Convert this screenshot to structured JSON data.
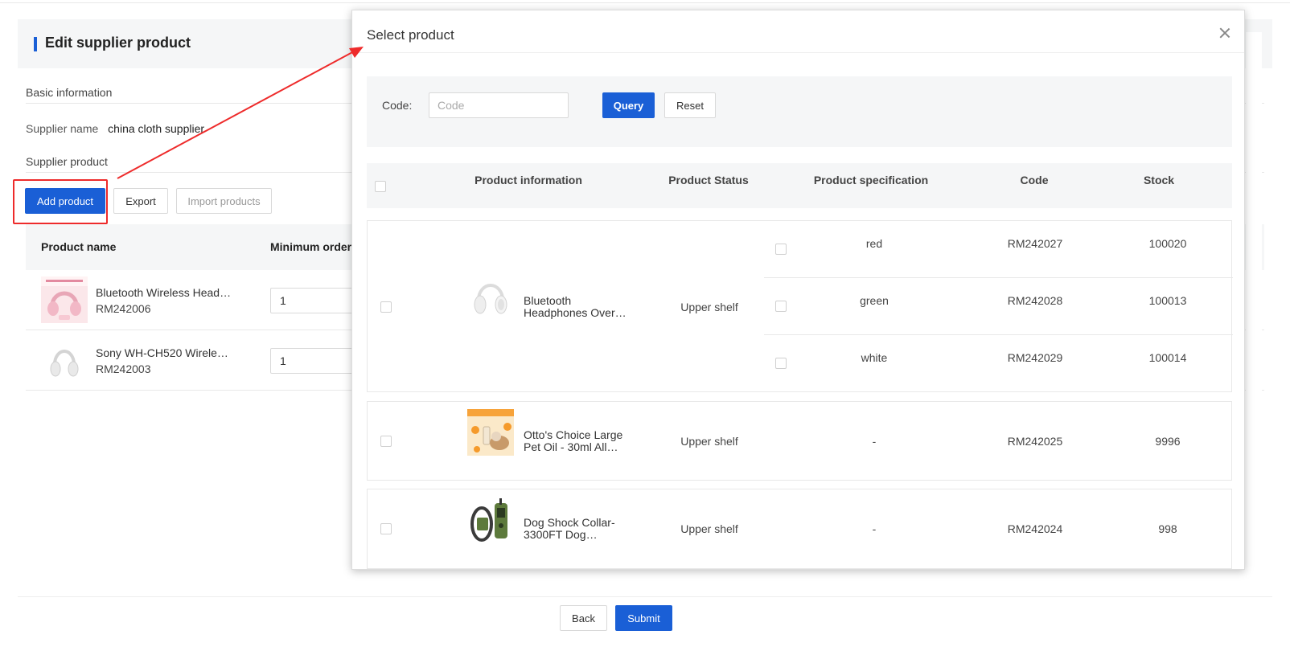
{
  "page": {
    "title": "Edit supplier product",
    "basic_info_label": "Basic information",
    "supplier_name_label": "Supplier name",
    "supplier_name_value": "china cloth supplier",
    "supplier_product_label": "Supplier product"
  },
  "toolbar": {
    "add_product": "Add product",
    "export": "Export",
    "import_products": "Import products"
  },
  "base_table": {
    "headers": {
      "product_name": "Product name",
      "minimum_order": "Minimum order"
    },
    "rows": [
      {
        "name": "Bluetooth Wireless Head…",
        "code": "RM242006",
        "qty": "1"
      },
      {
        "name": "Sony WH-CH520 Wirele…",
        "code": "RM242003",
        "qty": "1"
      }
    ]
  },
  "footer": {
    "back": "Back",
    "submit": "Submit"
  },
  "modal": {
    "title": "Select product",
    "filter": {
      "code_label": "Code:",
      "code_placeholder": "Code",
      "query": "Query",
      "reset": "Reset"
    },
    "headers": {
      "product_information": "Product information",
      "product_status": "Product Status",
      "product_specification": "Product specification",
      "code": "Code",
      "stock": "Stock"
    },
    "products": [
      {
        "name": "Bluetooth Headphones Over…",
        "status": "Upper shelf",
        "variants": [
          {
            "spec": "red",
            "code": "RM242027",
            "stock": "100020"
          },
          {
            "spec": "green",
            "code": "RM242028",
            "stock": "100013"
          },
          {
            "spec": "white",
            "code": "RM242029",
            "stock": "100014"
          }
        ]
      },
      {
        "name": "Otto's Choice Large Pet Oil - 30ml All…",
        "status": "Upper shelf",
        "spec": "-",
        "code": "RM242025",
        "stock": "9996"
      },
      {
        "name": "Dog Shock Collar-3300FT Dog…",
        "status": "Upper shelf",
        "spec": "-",
        "code": "RM242024",
        "stock": "998"
      }
    ]
  },
  "colors": {
    "primary": "#1a5fd6",
    "annotation_red": "#ee2b2b"
  }
}
